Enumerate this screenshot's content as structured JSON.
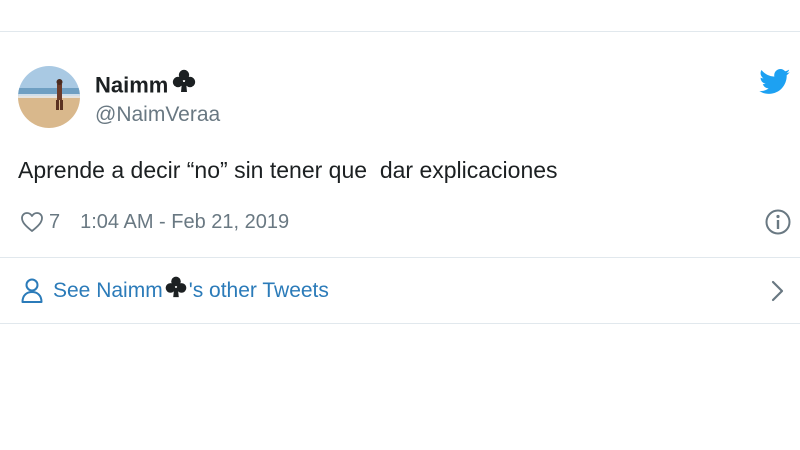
{
  "author": {
    "display_name": "Naimm",
    "name_emoji": "♣",
    "handle": "@NaimVeraa"
  },
  "tweet": {
    "text": "Aprende a decir “no” sin tener que  dar explicaciones",
    "likes": "7",
    "timestamp": "1:04 AM - Feb 21, 2019"
  },
  "footer": {
    "prefix": "See Naimm",
    "emoji": "♣",
    "suffix": "'s other Tweets"
  },
  "icons": {
    "brand": "twitter-bird-icon",
    "like": "heart-icon",
    "info": "info-icon",
    "profile": "person-icon",
    "next": "chevron-right-icon",
    "name_decoration": "club-icon"
  },
  "colors": {
    "brand": "#1da1f2",
    "link": "#2b7bb9",
    "text": "#1c2022",
    "secondary": "#697882",
    "border": "#e1e8ed"
  }
}
